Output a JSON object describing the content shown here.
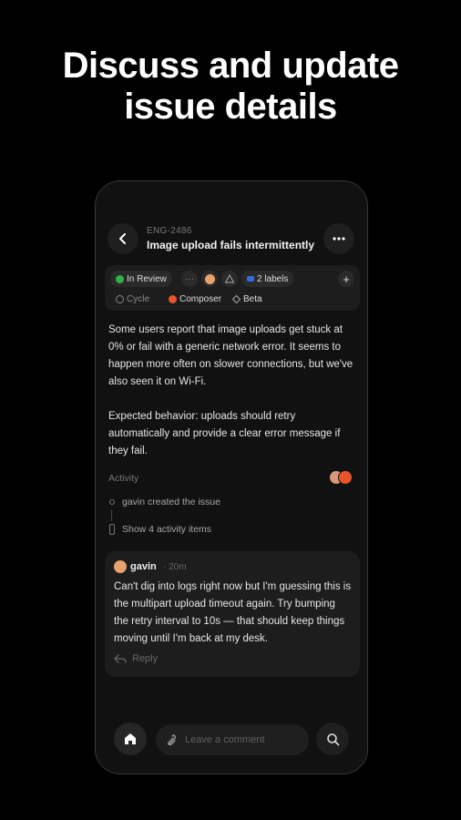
{
  "headline": {
    "line1": "Discuss and update",
    "line2": "issue details"
  },
  "header": {
    "issue_id": "ENG-2486",
    "title": "Image upload fails intermittently"
  },
  "properties": {
    "status": "In Review",
    "labels": "2 labels",
    "cycle": "Cycle",
    "label_1": "Composer",
    "label_2": "Beta",
    "status_color": "#2fb34a",
    "composer_color": "#e8552a",
    "labels_color": "#2f6de8"
  },
  "description": {
    "para1": "Some users report that image uploads get stuck at 0% or fail with a generic network error. It seems to happen more often on slower connections, but we've also seen it on Wi-Fi.",
    "para2": "Expected behavior: uploads should retry automatically and provide a clear error message if they fail."
  },
  "activity": {
    "label": "Activity",
    "created": "gavin created the issue",
    "show_more": "Show 4 activity items"
  },
  "comment": {
    "author": "gavin",
    "time": "· 20m",
    "body": "Can't dig into logs right now but I'm guessing this is the multipart upload timeout again. Try bumping the retry interval to 10s — that should keep things moving until I'm back at my desk.",
    "reply_label": "Reply"
  },
  "composer": {
    "placeholder": "Leave a comment"
  },
  "icons": {
    "back": "chevron-left-icon",
    "more": "ellipsis-icon",
    "add": "plus-icon",
    "home": "home-icon",
    "attach": "paperclip-icon",
    "search": "search-icon",
    "reply": "reply-arrow-icon"
  }
}
